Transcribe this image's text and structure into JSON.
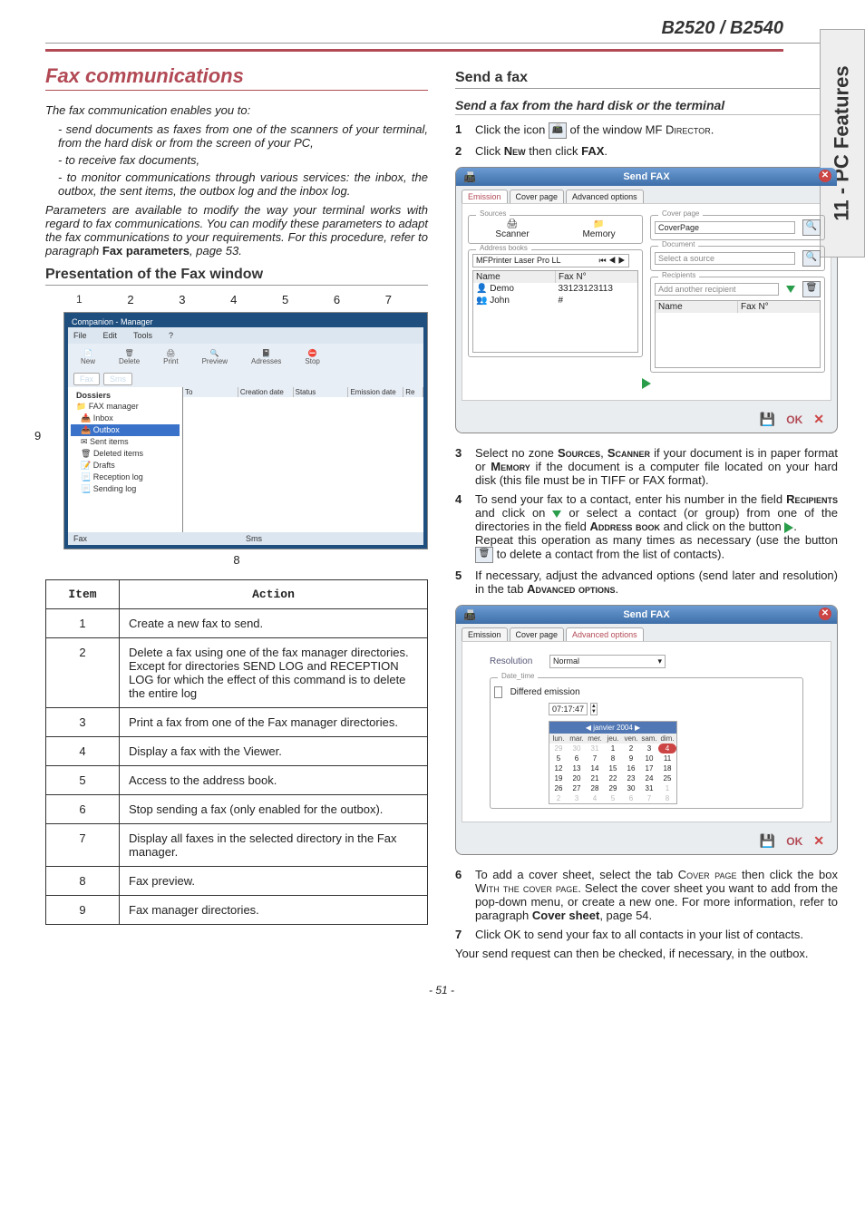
{
  "header": {
    "model": "B2520 / B2540"
  },
  "side_tab": "11 - PC Features",
  "footer_page": "- 51 -",
  "left": {
    "title": "Fax communications",
    "intro": "The fax communication enables you to:",
    "bullets": [
      "send documents as faxes from one of the scanners of your terminal, from the hard disk or from the screen of your PC,",
      "to receive fax documents,",
      "to monitor communications through various services: the inbox, the outbox, the sent items, the outbox log and the inbox log."
    ],
    "para2_a": "Parameters are available to modify the way your terminal works with regard to fax communications. You can modify these parameters to adapt the fax communications to your requirements. For this procedure, refer to paragraph ",
    "para2_b": "Fax parameters",
    "para2_c": ", page 53.",
    "presentation_heading": "Presentation of the Fax window",
    "diagram": {
      "window_title": "Companion - Manager",
      "menus": [
        "File",
        "Edit",
        "Tools",
        "?"
      ],
      "buttons": [
        "New",
        "Delete",
        "Print",
        "Preview",
        "Adresses",
        "Stop"
      ],
      "subtabs": [
        "Fax",
        "Sms"
      ],
      "grid_headers": [
        "To",
        "Creation date",
        "Status",
        "Emission date",
        "Re"
      ],
      "tree_title": "Dossiers",
      "tree": [
        "FAX manager",
        "Inbox",
        "Outbox",
        "Sent items",
        "Deleted items",
        "Drafts",
        "Reception log",
        "Sending log"
      ],
      "status_bar_left": "Fax",
      "status_bar_mid": "Sms",
      "labels": [
        "1",
        "2",
        "3",
        "4",
        "5",
        "6",
        "7",
        "8",
        "9"
      ]
    },
    "table": {
      "headers": [
        "Item",
        "Action"
      ],
      "rows": [
        {
          "item": "1",
          "action": "Create a new fax to send."
        },
        {
          "item": "2",
          "action": "Delete a fax using one of the fax manager directories. Except for directories SEND LOG and RECEPTION LOG for which the effect of this command is to delete the entire log"
        },
        {
          "item": "3",
          "action": "Print a fax from one of the Fax manager directories."
        },
        {
          "item": "4",
          "action": "Display a fax with the Viewer."
        },
        {
          "item": "5",
          "action": "Access to the address book."
        },
        {
          "item": "6",
          "action": "Stop sending a fax (only enabled for the outbox)."
        },
        {
          "item": "7",
          "action": "Display all faxes in the selected directory in the Fax manager."
        },
        {
          "item": "8",
          "action": "Fax preview."
        },
        {
          "item": "9",
          "action": "Fax manager directories."
        }
      ]
    }
  },
  "right": {
    "h2": "Send a fax",
    "h3": "Send a fax from the hard disk or the terminal",
    "steps_a": [
      {
        "n": "1",
        "html": "Click the icon [ICON] of the window MF DIRECTOR."
      },
      {
        "n": "2",
        "html": "Click NEW then click FAX."
      }
    ],
    "sendfax_win": {
      "title": "Send FAX",
      "tabs": [
        "Emission",
        "Cover page",
        "Advanced options"
      ],
      "sources_label": "Sources",
      "scanner": "Scanner",
      "memory": "Memory",
      "addrbook_label": "Address books",
      "addrbook_name": "MFPrinter Laser Pro LL",
      "tbl_head": [
        "Name",
        "Fax N°"
      ],
      "tbl_rows": [
        {
          "name": "Demo",
          "fax": "33123123113"
        },
        {
          "name": "John",
          "fax": "#"
        }
      ],
      "coverpage_label": "Cover page",
      "coverpage_field": "CoverPage",
      "document_label": "Document",
      "document_field": "Select a source",
      "recipients_label": "Recipients",
      "recipients_field": "Add another recipient",
      "recip_head": [
        "Name",
        "Fax N°"
      ],
      "footer_ok": "OK"
    },
    "steps_b": [
      {
        "n": "3",
        "html": "Select no zone SOURCES, SCANNER if your document is in paper format or MEMORY if the document is a computer file located on your hard disk (this file must be in TIFF or FAX format)."
      },
      {
        "n": "4",
        "html": "To send your fax to a contact, enter his number in the field RECIPIENTS and click on ▽ or select a contact (or group) from one of the directories in the field ADDRESS BOOK and click on the button ▶.<br>Repeat this operation as many times as necessary (use the button 🗑 to delete a contact from the list of contacts)."
      },
      {
        "n": "5",
        "html": "If necessary, adjust the advanced options (send later and resolution) in the tab ADVANCED OPTIONS."
      }
    ],
    "adv_win": {
      "title": "Send FAX",
      "tabs": [
        "Emission",
        "Cover page",
        "Advanced options"
      ],
      "res_label": "Resolution",
      "res_value": "Normal",
      "date_group": "Date_time",
      "defer_label": "Differed emission",
      "time_value": "07:17:47",
      "cal_title": "janvier 2004",
      "days": [
        "lun.",
        "mar.",
        "mer.",
        "jeu.",
        "ven.",
        "sam.",
        "dim."
      ],
      "cells": [
        "29",
        "30",
        "31",
        "1",
        "2",
        "3",
        "4",
        "5",
        "6",
        "7",
        "8",
        "9",
        "10",
        "11",
        "12",
        "13",
        "14",
        "15",
        "16",
        "17",
        "18",
        "19",
        "20",
        "21",
        "22",
        "23",
        "24",
        "25",
        "26",
        "27",
        "28",
        "29",
        "30",
        "31",
        "1",
        "2",
        "3",
        "4",
        "5",
        "6",
        "7",
        "8"
      ],
      "selected": "4",
      "footer_ok": "OK"
    },
    "steps_c": [
      {
        "n": "6",
        "html": "To add a cover sheet, select the tab COVER PAGE then click the box WITH THE COVER PAGE. Select the cover sheet you want to add from the pop-down menu, or create a new one. For more information, refer to paragraph Cover sheet, page 54."
      },
      {
        "n": "7",
        "html": "Click OK to send your fax to all contacts in your list of contacts."
      }
    ],
    "closing": "Your send request can then be checked, if necessary, in the outbox."
  }
}
